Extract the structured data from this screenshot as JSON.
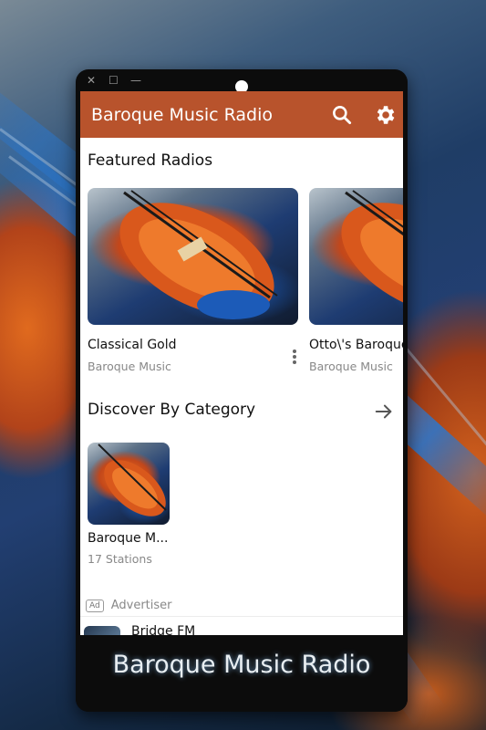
{
  "window": {
    "close_glyph": "✕",
    "maximize_glyph": "☐",
    "minimize_glyph": "—"
  },
  "appbar": {
    "title": "Baroque Music Radio",
    "search_icon": "search-icon",
    "settings_icon": "gear-icon",
    "color": "#b8532c"
  },
  "featured": {
    "title": "Featured Radios",
    "items": [
      {
        "name": "Classical Gold",
        "genre": "Baroque Music"
      },
      {
        "name": "Otto\\'s Baroque",
        "genre": "Baroque Music"
      }
    ]
  },
  "discover": {
    "title": "Discover By Category",
    "arrow_icon": "arrow-right-icon",
    "categories": [
      {
        "name": "Baroque M...",
        "count": "17 Stations"
      }
    ]
  },
  "ad": {
    "badge": "Ad",
    "label": "Advertiser",
    "item_name": "Bridge FM"
  },
  "caption": "Baroque Music Radio"
}
